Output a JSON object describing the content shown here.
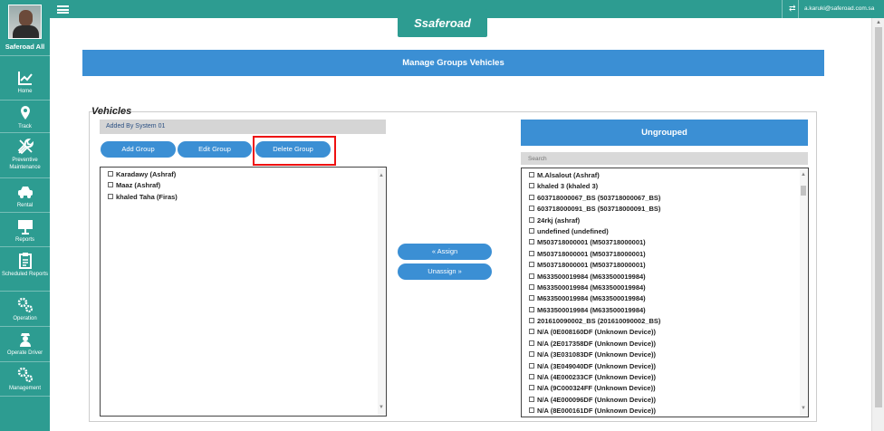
{
  "sidebar": {
    "user_name": "Saferoad All",
    "items": [
      {
        "label": "Home",
        "icon": "chart-icon"
      },
      {
        "label": "Track",
        "icon": "map-pin-icon"
      },
      {
        "label": "Preventive Maintenance",
        "icon": "wrench-icon"
      },
      {
        "label": "Rental",
        "icon": "car-icon"
      },
      {
        "label": "Reports",
        "icon": "presentation-icon"
      },
      {
        "label": "Scheduled Reports",
        "icon": "clipboard-icon"
      },
      {
        "label": "Operation",
        "icon": "gears-icon"
      },
      {
        "label": "Operate Driver",
        "icon": "driver-icon"
      },
      {
        "label": "Management",
        "icon": "settings-icon"
      }
    ]
  },
  "topbar": {
    "email": "a.karuki@saferoad.com.sa",
    "logo_text": "saferoad",
    "logo_mark": "S"
  },
  "page": {
    "title": "Manage Groups Vehicles",
    "section_title": "Vehicles"
  },
  "groups": {
    "selected": "Added By System 01",
    "buttons": {
      "add": "Add Group",
      "edit": "Edit Group",
      "delete": "Delete Group"
    },
    "vehicles": [
      "Karadawy (Ashraf)",
      "Maaz (Ashraf)",
      "khaled Taha (Firas)"
    ]
  },
  "transfer": {
    "assign": "« Assign",
    "unassign": "Unassign »"
  },
  "ungrouped": {
    "title": "Ungrouped",
    "search_placeholder": "Search",
    "vehicles": [
      "M.Alsalout (Ashraf)",
      "khaled 3 (khaled 3)",
      "603718000067_BS (503718000067_BS)",
      "603718000091_BS (503718000091_BS)",
      "24rkj (ashraf)",
      "undefined (undefined)",
      "M503718000001 (M503718000001)",
      "M503718000001 (M503718000001)",
      "M503718000001 (M503718000001)",
      "M633500019984 (M633500019984)",
      "M633500019984 (M633500019984)",
      "M633500019984 (M633500019984)",
      "M633500019984 (M633500019984)",
      "201610090002_BS (201610090002_BS)",
      "N/A (0E008160DF (Unknown Device))",
      "N/A (2E017358DF (Unknown Device))",
      "N/A (3E031083DF (Unknown Device))",
      "N/A (3E049040DF (Unknown Device))",
      "N/A (4E000233CF (Unknown Device))",
      "N/A (9C000324FF (Unknown Device))",
      "N/A (4E000096DF (Unknown Device))",
      "N/A (8E000161DF (Unknown Device))"
    ]
  },
  "colors": {
    "sidebar": "#2d9c91",
    "accent": "#3b8fd4",
    "highlight": "#ee1111"
  }
}
